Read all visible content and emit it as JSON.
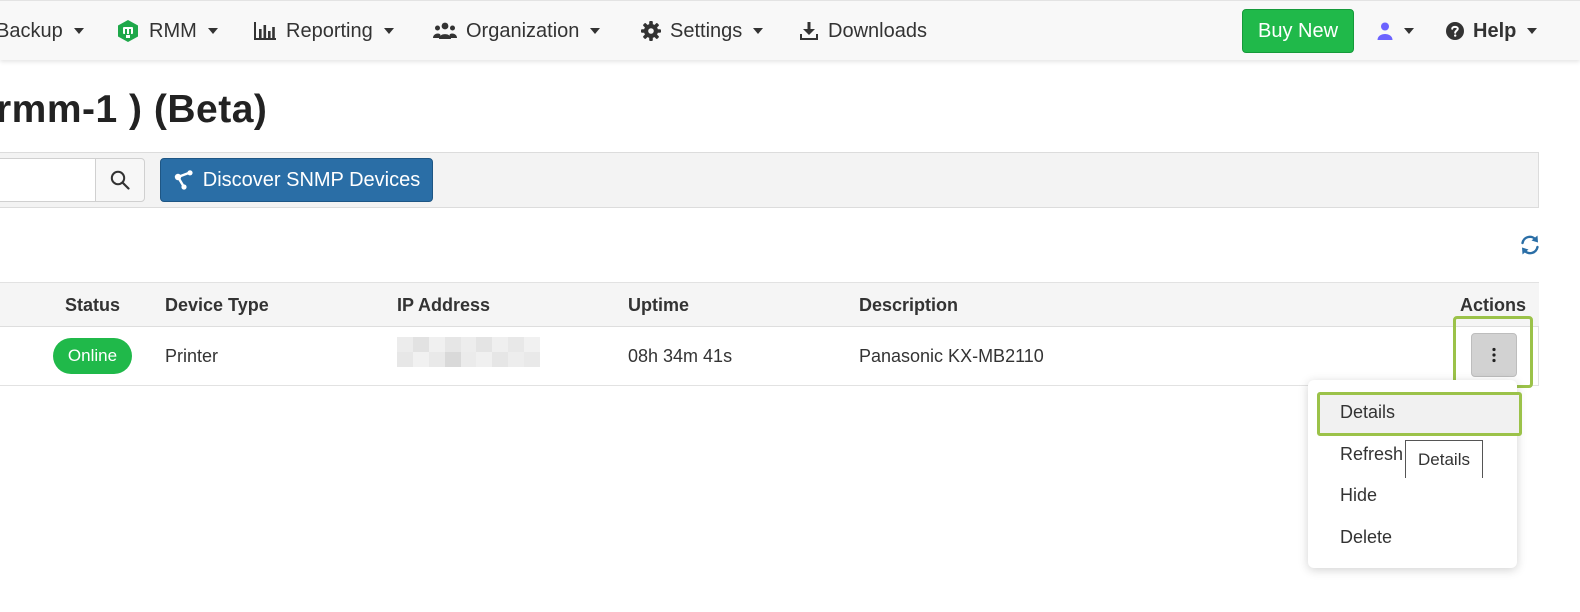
{
  "nav": {
    "items": [
      {
        "label": "Backup",
        "has_caret": true
      },
      {
        "label": "RMM",
        "has_caret": true
      },
      {
        "label": "Reporting",
        "has_caret": true
      },
      {
        "label": "Organization",
        "has_caret": true
      },
      {
        "label": "Settings",
        "has_caret": true
      },
      {
        "label": "Downloads",
        "has_caret": false
      }
    ],
    "buy_button": "Buy New",
    "help_label": "Help"
  },
  "page": {
    "title": "rmm-1 ) (Beta)"
  },
  "toolbar": {
    "search_value": "",
    "discover_button": "Discover SNMP Devices"
  },
  "table": {
    "columns": [
      "Status",
      "Device Type",
      "IP Address",
      "Uptime",
      "Description",
      "Actions"
    ],
    "rows": [
      {
        "status": "Online",
        "device_type": "Printer",
        "uptime": "08h 34m 41s",
        "description": "Panasonic KX-MB2110"
      }
    ]
  },
  "actions_menu": {
    "items": [
      "Details",
      "Refresh",
      "Hide",
      "Delete"
    ],
    "tooltip": "Details"
  },
  "colors": {
    "green": "#20b94a",
    "blue": "#2a6ea6",
    "highlight": "#9bc249",
    "user_icon": "#6c63ff"
  }
}
